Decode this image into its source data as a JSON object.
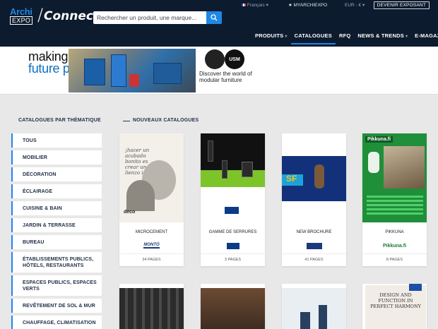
{
  "header": {
    "logo_top": "Archi",
    "logo_bottom": "EXPO",
    "logo_right": "Connect",
    "search_placeholder": "Rechercher un produit, une marque...",
    "language": "Français",
    "my_account": "MYARCHIEXPO",
    "currency": "EUR - €",
    "become_exhibitor": "DEVENIR EXPOSANT",
    "nav": [
      {
        "label": "PRODUITS",
        "chevron": true
      },
      {
        "label": "CATALOGUES",
        "chevron": false,
        "active": true
      },
      {
        "label": "RFQ",
        "chevron": false
      },
      {
        "label": "NEWS & TRENDS",
        "chevron": true
      },
      {
        "label": "E-MAGAZINE",
        "chevron": false
      }
    ]
  },
  "banner": {
    "line1": "making places",
    "line2": "future proof",
    "brand": "USM",
    "discover": "Discover the world of modular furniture"
  },
  "sidebar": {
    "title": "CATALOGUES PAR THÉMATIQUE",
    "items": [
      "TOUS",
      "MOBILIER",
      "DÉCORATION",
      "ÉCLAIRAGE",
      "CUISINE & BAIN",
      "JARDIN & TERRASSE",
      "BUREAU",
      "ÉTABLISSEMENTS PUBLICS, HÔTELS, RESTAURANTS",
      "ESPACES PUBLICS, ESPACES VERTS",
      "REVÊTEMENT DE SOL & MUR",
      "CHAUFFAGE, CLIMATISATION"
    ]
  },
  "catalogues": {
    "title": "NOUVEAUX CATALOGUES",
    "items": [
      {
        "title": "MICROCEMENT",
        "brand": "MONTÓ",
        "pages": "34 PAGES"
      },
      {
        "title": "GAMME DE SERRURES",
        "brand": "",
        "pages": "3 PAGES"
      },
      {
        "title": "NEW BROCHURE",
        "brand": "",
        "pages": "41 PAGES"
      },
      {
        "title": "PIKKUNA",
        "brand": "Pikkuna.fi",
        "pages": "8 PAGES"
      }
    ],
    "cover_texts": {
      "c1_script": "¡hacer un acabado bonito es crear un lienzo infinito!",
      "c1_logo": "deco",
      "c4_logo": "Pikkuna.fi",
      "c3_logo": "SF",
      "c8_text": "DESIGN AND FUNCTION IN PERFECT HARMONY"
    }
  },
  "colors": {
    "header_bg": "#0d1b2e",
    "accent": "#1e88e5",
    "page_bg": "#e8e8e8"
  }
}
